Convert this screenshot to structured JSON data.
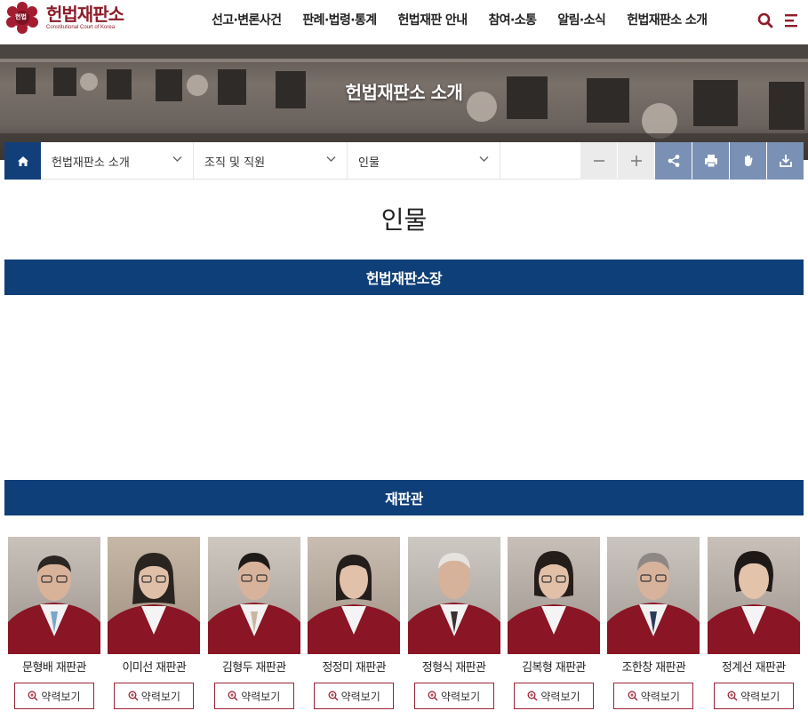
{
  "brand": {
    "title": "헌법재판소",
    "subtitle": "Constitutional Court of Korea",
    "emblem_text": "헌법",
    "colors": {
      "maroon": "#8c1d2a",
      "navy": "#0f3f78",
      "tool_blue": "#7a90b4"
    }
  },
  "gnb": {
    "items": [
      {
        "label": "선고·변론사건"
      },
      {
        "label": "판례·법령·통계"
      },
      {
        "label": "헌법재판 안내"
      },
      {
        "label": "참여·소통"
      },
      {
        "label": "알림·소식"
      },
      {
        "label": "헌법재판소 소개"
      }
    ],
    "search_icon": "search-icon",
    "menu_icon": "menu-icon"
  },
  "banner": {
    "title": "헌법재판소 소개"
  },
  "location": {
    "home_icon": "home-icon",
    "level1": "헌법재판소 소개",
    "level2": "조직 및 직원",
    "level3": "인물",
    "tools": [
      "zoom-out-icon",
      "zoom-in-icon",
      "share-icon",
      "print-icon",
      "sign-language-icon",
      "download-icon"
    ]
  },
  "page": {
    "title": "인물",
    "section_president": "헌법재판소장",
    "section_justices": "재판관"
  },
  "justices": [
    {
      "name": "문형배 재판관",
      "button": "약력보기"
    },
    {
      "name": "이미선 재판관",
      "button": "약력보기"
    },
    {
      "name": "김형두 재판관",
      "button": "약력보기"
    },
    {
      "name": "정정미 재판관",
      "button": "약력보기"
    },
    {
      "name": "정형식 재판관",
      "button": "약력보기"
    },
    {
      "name": "김복형 재판관",
      "button": "약력보기"
    },
    {
      "name": "조한창 재판관",
      "button": "약력보기"
    },
    {
      "name": "정계선 재판관",
      "button": "약력보기"
    }
  ]
}
